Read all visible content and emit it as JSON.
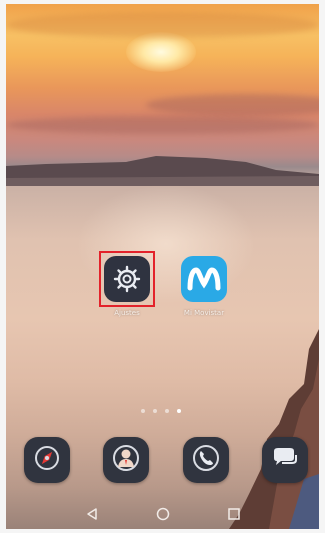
{
  "home_screen": {
    "apps": [
      {
        "label": "Ajustes",
        "icon": "settings-gear-icon",
        "highlighted": true
      },
      {
        "label": "Mi Movistar",
        "icon": "movistar-logo-icon"
      }
    ],
    "page_indicator": {
      "pages": 4,
      "current": 4
    }
  },
  "dock": [
    {
      "icon": "browser-compass-icon"
    },
    {
      "icon": "contacts-icon"
    },
    {
      "icon": "phone-icon"
    },
    {
      "icon": "messages-icon"
    }
  ],
  "navigation_bar": [
    {
      "icon": "back-icon"
    },
    {
      "icon": "home-icon"
    },
    {
      "icon": "recents-icon"
    }
  ],
  "colors": {
    "highlight_border": "#e3222a",
    "movistar_blue": "#2aa9e6",
    "icon_dark": "#2f3340"
  }
}
